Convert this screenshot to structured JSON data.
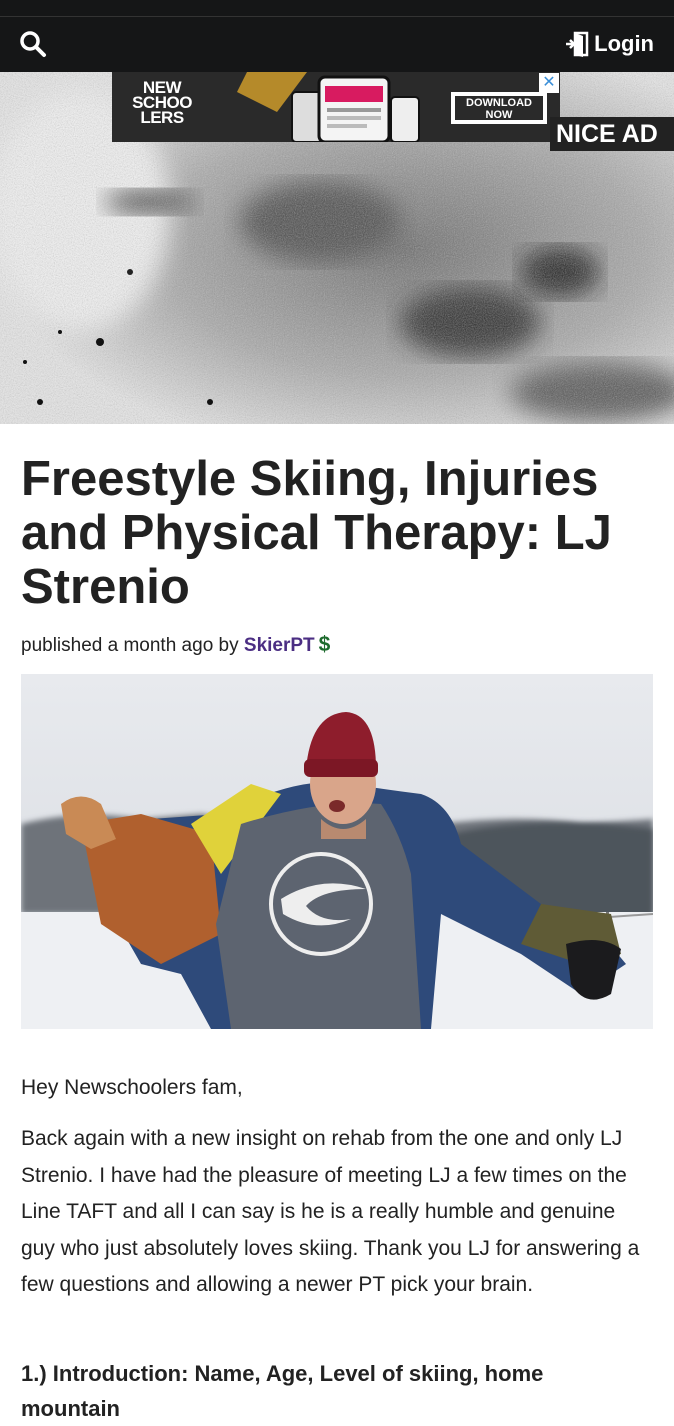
{
  "nav": {
    "login_label": "Login"
  },
  "ad": {
    "logo_lines": [
      "NEW",
      "SCHOO",
      "LERS"
    ],
    "download_label": "DOWNLOAD NOW",
    "close_symbol": "✕",
    "nice_ad_label": "NICE AD"
  },
  "article": {
    "title": "Freestyle Skiing, Injuries and Physical Therapy: LJ Strenio",
    "byline_prefix": "published a month ago by",
    "author": "SkierPT",
    "author_badge": "$",
    "greeting": "Hey Newschoolers fam,",
    "intro_paragraph": "Back again with a new insight on rehab from the one and only LJ Strenio. I have had the pleasure of meeting LJ a few times on the Line TAFT and all I can say is he is a really humble and genuine guy who just absolutely loves skiing. Thank you LJ for answering a few questions and allowing a newer PT pick your brain.",
    "question_1": "1.) Introduction: Name, Age, Level of skiing, home mountain"
  },
  "icons": {
    "search": "search-icon",
    "login": "login-door-icon"
  },
  "colors": {
    "navbar": "#151617",
    "author": "#4b2e83",
    "badge": "#1e6b2e",
    "ad_close": "#3b8fd8"
  }
}
